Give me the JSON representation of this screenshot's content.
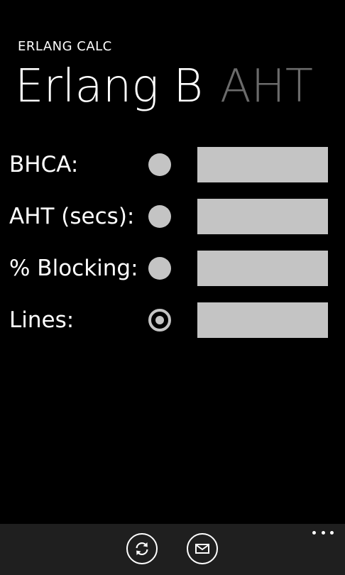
{
  "app": {
    "title": "ERLANG CALC"
  },
  "pivot": {
    "items": [
      {
        "label": "Erlang B",
        "active": true
      },
      {
        "label": "AHT",
        "active": false
      }
    ]
  },
  "form": {
    "rows": [
      {
        "label": "BHCA:",
        "selected": false,
        "value": ""
      },
      {
        "label": "AHT (secs):",
        "selected": false,
        "value": ""
      },
      {
        "label": "% Blocking:",
        "selected": false,
        "value": ""
      },
      {
        "label": "Lines:",
        "selected": true,
        "value": ""
      }
    ]
  },
  "app_bar": {
    "buttons": [
      {
        "icon": "refresh-icon"
      },
      {
        "icon": "mail-icon"
      }
    ],
    "more_icon": "ellipsis-icon"
  },
  "colors": {
    "background": "#000000",
    "foreground": "#ffffff",
    "inactive_header": "#6b6b6b",
    "control_fill": "#c4c4c4",
    "app_bar": "#1f1f1f"
  }
}
